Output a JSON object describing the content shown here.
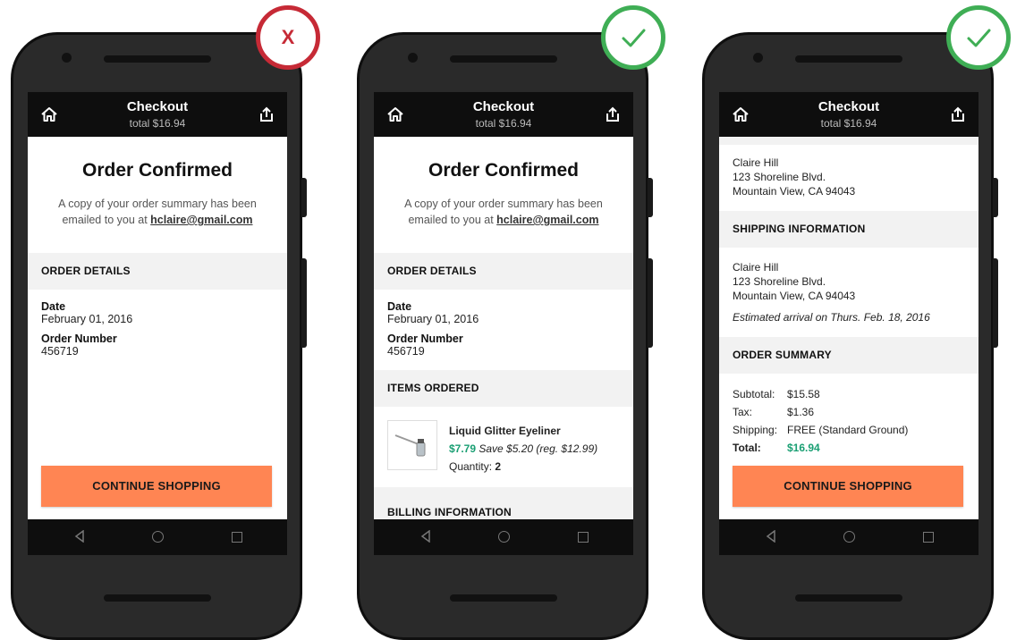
{
  "header": {
    "title": "Checkout",
    "subtitle": "total $16.94"
  },
  "confirm": {
    "title": "Order Confirmed",
    "text": "A copy of your order summary has been emailed to you at",
    "email": "hclaire@gmail.com"
  },
  "order_details": {
    "heading": "ORDER DETAILS",
    "date_label": "Date",
    "date_value": "February 01, 2016",
    "number_label": "Order Number",
    "number_value": "456719"
  },
  "items": {
    "heading": "ITEMS ORDERED",
    "name": "Liquid Glitter Eyeliner",
    "price": "$7.79",
    "save": "Save $5.20 (reg. $12.99)",
    "quantity_label": "Quantity:",
    "quantity": "2"
  },
  "billing": {
    "heading": "BILLING INFORMATION"
  },
  "address": {
    "name": "Claire Hill",
    "line1": "123 Shoreline Blvd.",
    "line2": "Mountain View, CA 94043"
  },
  "shipping": {
    "heading": "SHIPPING INFORMATION",
    "eta": "Estimated arrival on Thurs. Feb. 18, 2016"
  },
  "summary": {
    "heading": "ORDER SUMMARY",
    "subtotal_label": "Subtotal:",
    "subtotal": "$15.58",
    "tax_label": "Tax:",
    "tax": "$1.36",
    "shipping_label": "Shipping:",
    "shipping": "FREE (Standard Ground)",
    "total_label": "Total:",
    "total": "$16.94"
  },
  "cta": "CONTINUE SHOPPING",
  "badges": {
    "wrong": "X"
  },
  "colors": {
    "accent": "#ff8553",
    "price": "#1a9f73",
    "wrong": "#c62a36",
    "right": "#3fae55"
  }
}
